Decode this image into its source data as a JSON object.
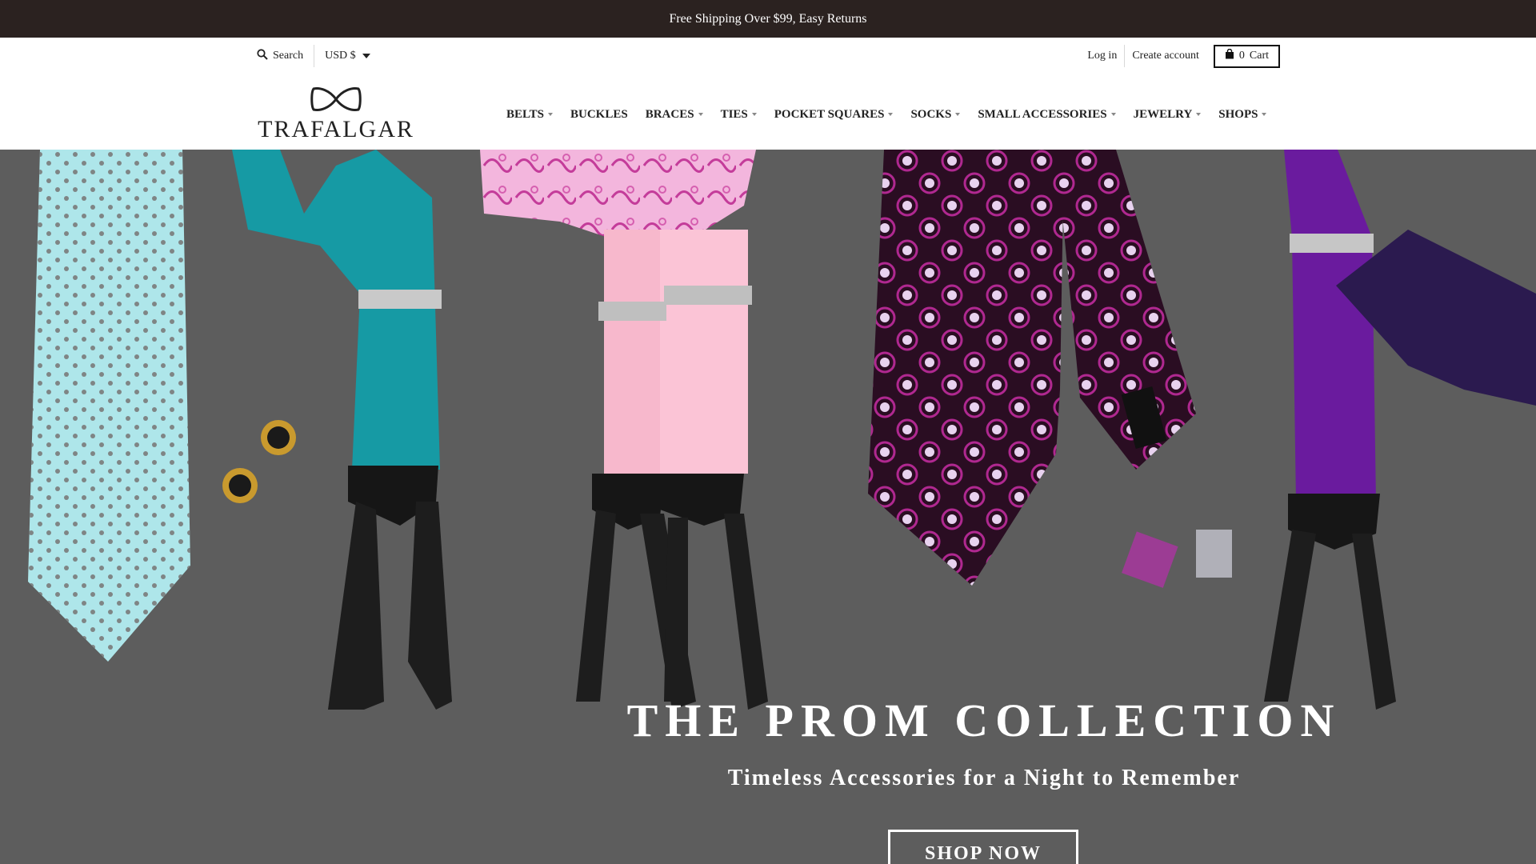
{
  "announcement": {
    "text": "Free Shipping Over $99, Easy Returns"
  },
  "topbar": {
    "search_label": "Search",
    "currency_label": "USD $",
    "login_label": "Log in",
    "create_account_label": "Create account",
    "cart_count": "0",
    "cart_label": "Cart"
  },
  "logo": {
    "text": "TRAFALGAR"
  },
  "nav": {
    "items": [
      {
        "label": "BELTS",
        "dropdown": true
      },
      {
        "label": "BUCKLES",
        "dropdown": false
      },
      {
        "label": "BRACES",
        "dropdown": true
      },
      {
        "label": "TIES",
        "dropdown": true
      },
      {
        "label": "POCKET SQUARES",
        "dropdown": true
      },
      {
        "label": "SOCKS",
        "dropdown": true
      },
      {
        "label": "SMALL ACCESSORIES",
        "dropdown": true
      },
      {
        "label": "JEWELRY",
        "dropdown": true
      },
      {
        "label": "SHOPS",
        "dropdown": true
      }
    ]
  },
  "hero": {
    "title": "THE PROM COLLECTION",
    "subtitle": "Timeless Accessories for a Night to Remember",
    "cta_label": "SHOP NOW"
  },
  "icons": {
    "search": "search-icon",
    "currency_caret": "chevron-down-icon",
    "cart": "shopping-bag-icon",
    "logo_mark": "bow-tie-icon"
  },
  "colors": {
    "announcement_bg": "#2b2220",
    "hero_bg": "#5d5d5d",
    "text": "#222222"
  }
}
